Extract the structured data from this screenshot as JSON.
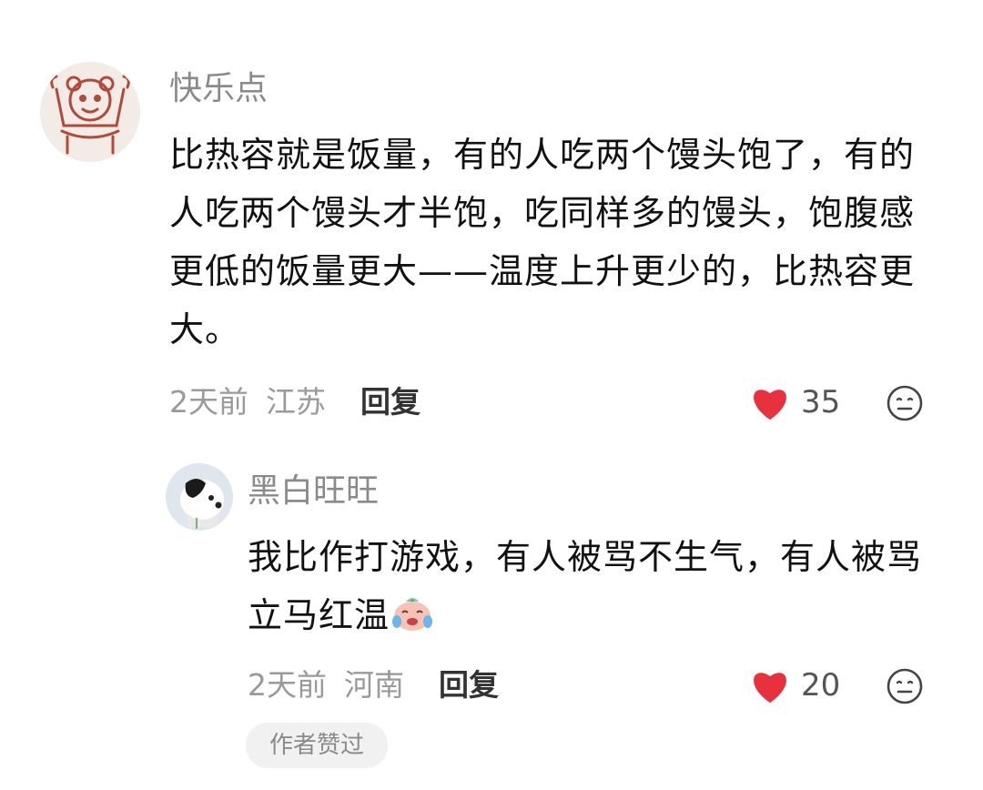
{
  "comment": {
    "username": "快乐点",
    "text": "比热容就是饭量，有的人吃两个馒头饱了，有的人吃两个馒头才半饱，吃同样多的馒头，饱腹感更低的饭量更大——温度上升更少的，比热容更大。",
    "time": "2天前",
    "location": "江苏",
    "reply_label": "回复",
    "likes": "35",
    "like_icon": "heart-icon",
    "dislike_icon": "neutral-face-icon",
    "like_color": "#e8313f"
  },
  "reply": {
    "username": "黑白旺旺",
    "text": "我比作打游戏，有人被骂不生气，有人被骂立马红温",
    "emoji": "crying-laughing-emoji",
    "time": "2天前",
    "location": "河南",
    "reply_label": "回复",
    "likes": "20",
    "author_badge": "作者赞过"
  }
}
